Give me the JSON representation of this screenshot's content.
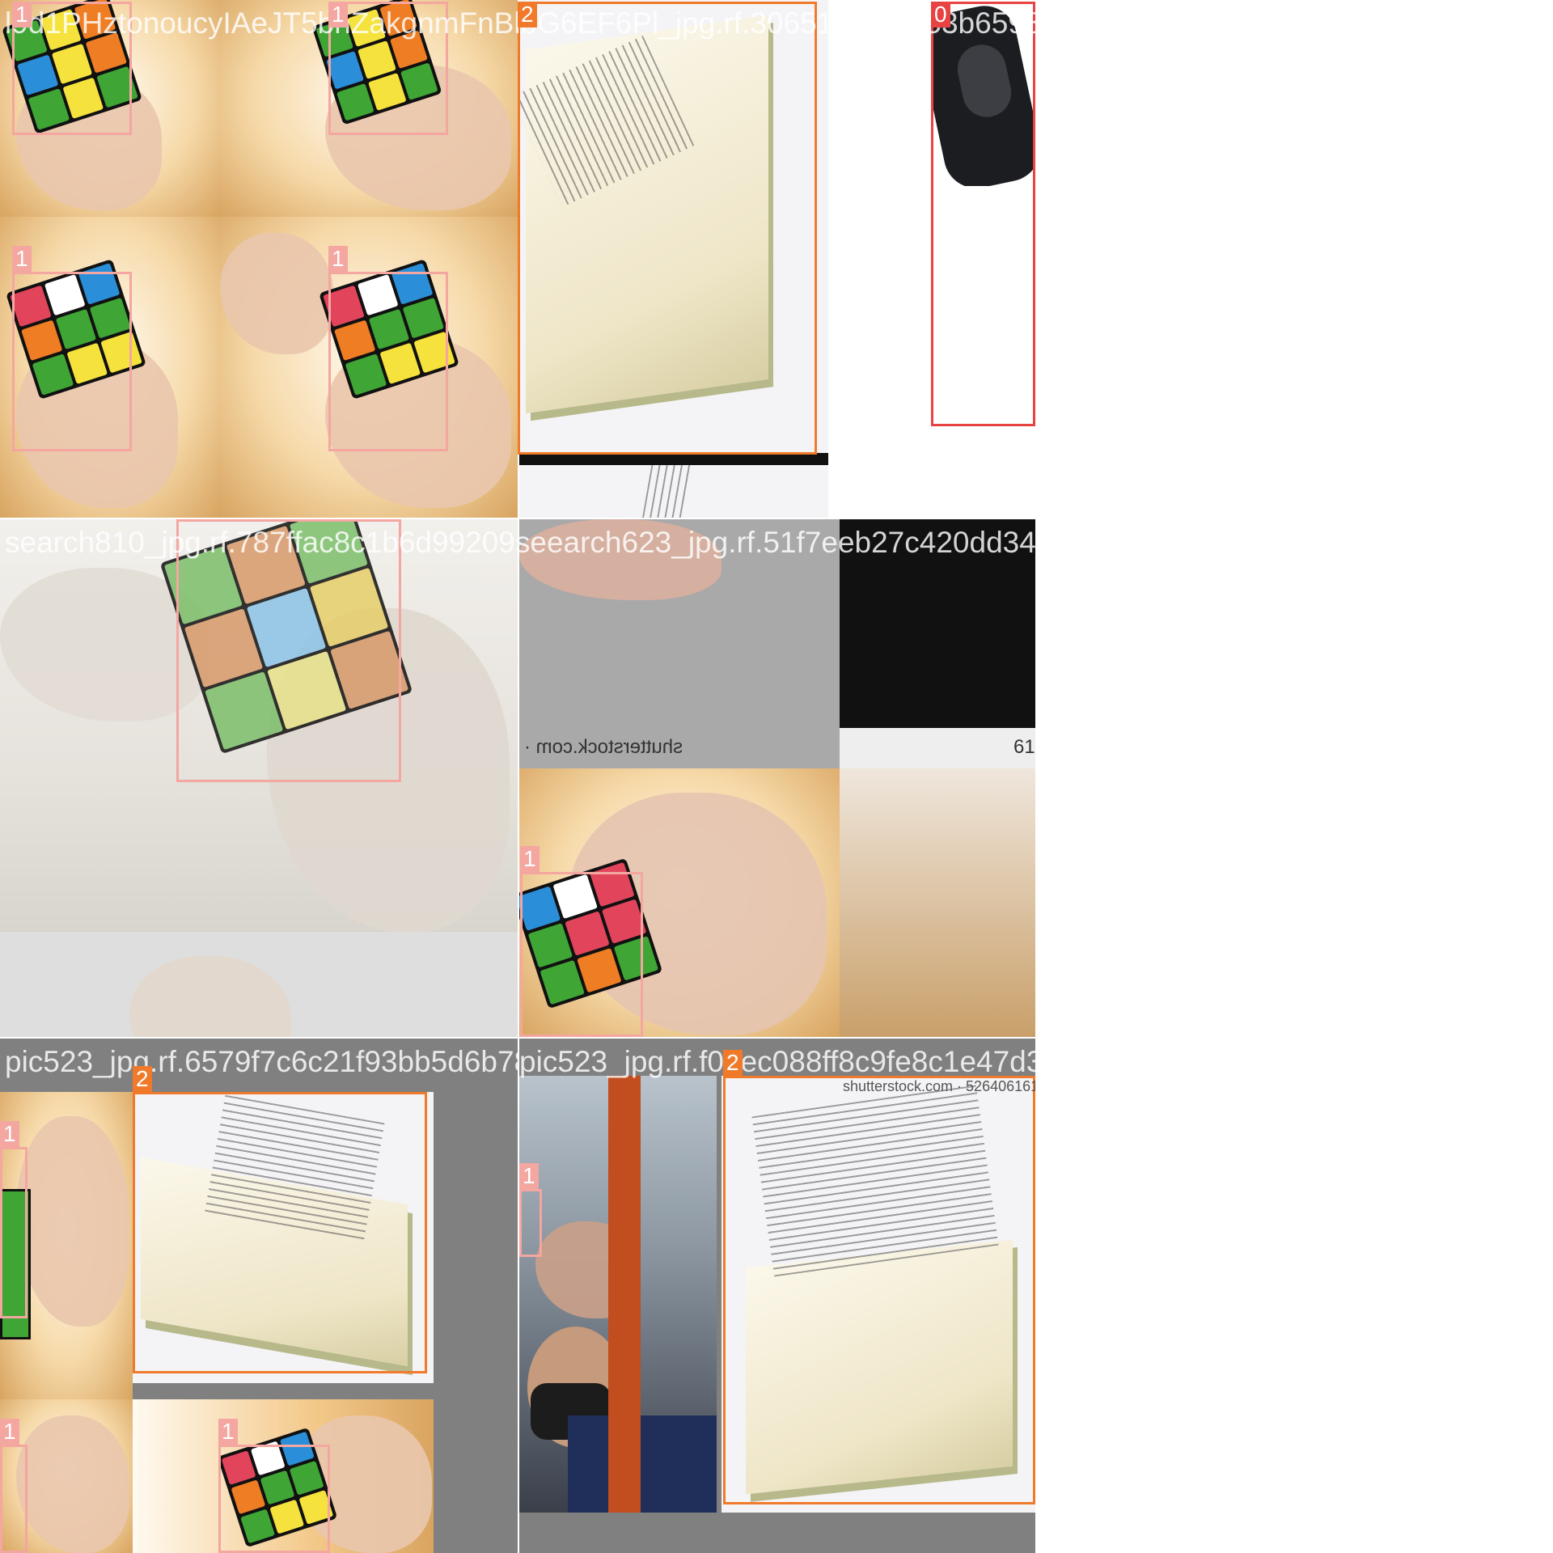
{
  "mosaic": {
    "background": "#ffffff",
    "colors": {
      "class_0": "#e84343",
      "class_1": "#f4a6a0",
      "class_2": "#f07a2a",
      "fill_grey": "#808080"
    },
    "tiles": [
      {
        "filename": "l9d1PHztonoucyIAeJT5bhZakgnmFnBlbG6EF6Pl_jpg.rf.3065189f43053b65982a1e",
        "boxes": [
          {
            "label": "1"
          },
          {
            "label": "1"
          },
          {
            "label": "1"
          },
          {
            "label": "1"
          },
          {
            "label": "2"
          },
          {
            "label": "0"
          }
        ]
      },
      {
        "filename": "search810_jpg.rf.787ffac8c1b6d99209seearch623_jpg.rf.51f7eeb27c420dd34d96832",
        "boxes": [
          {
            "label": "1"
          },
          {
            "label": "1"
          }
        ],
        "watermarks": [
          "shutterstock.com ·",
          "61"
        ]
      },
      {
        "filename": "pic523_jpg.rf.6579f7c6c21f93bb5d6b78d95a",
        "boxes": [
          {
            "label": "1"
          },
          {
            "label": "2"
          },
          {
            "label": "1"
          },
          {
            "label": "1"
          }
        ]
      },
      {
        "filename": "pic523_jpg.rf.f04ec088ff8c9fe8c1e47d3c",
        "boxes": [
          {
            "label": "1"
          },
          {
            "label": "2"
          }
        ],
        "watermarks": [
          "shutterstock.com · 526406161"
        ]
      }
    ]
  }
}
